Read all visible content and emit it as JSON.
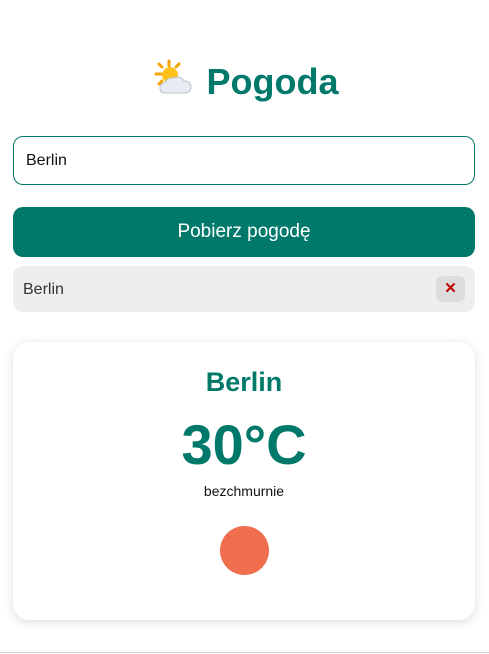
{
  "header": {
    "title": "Pogoda",
    "icon": "sun-behind-cloud-icon"
  },
  "search": {
    "value": "Berlin",
    "button_label": "Pobierz pogodę"
  },
  "history": [
    {
      "city": "Berlin",
      "remove_icon": "close-icon",
      "remove_label": "✕"
    }
  ],
  "weather": {
    "city": "Berlin",
    "temperature": "30°C",
    "description": "bezchmurnie",
    "icon": "sun-icon"
  },
  "colors": {
    "accent": "#00796b",
    "sun": "#ee6e4e",
    "history_bg": "#eeeeee",
    "remove_icon": "#c00000"
  }
}
